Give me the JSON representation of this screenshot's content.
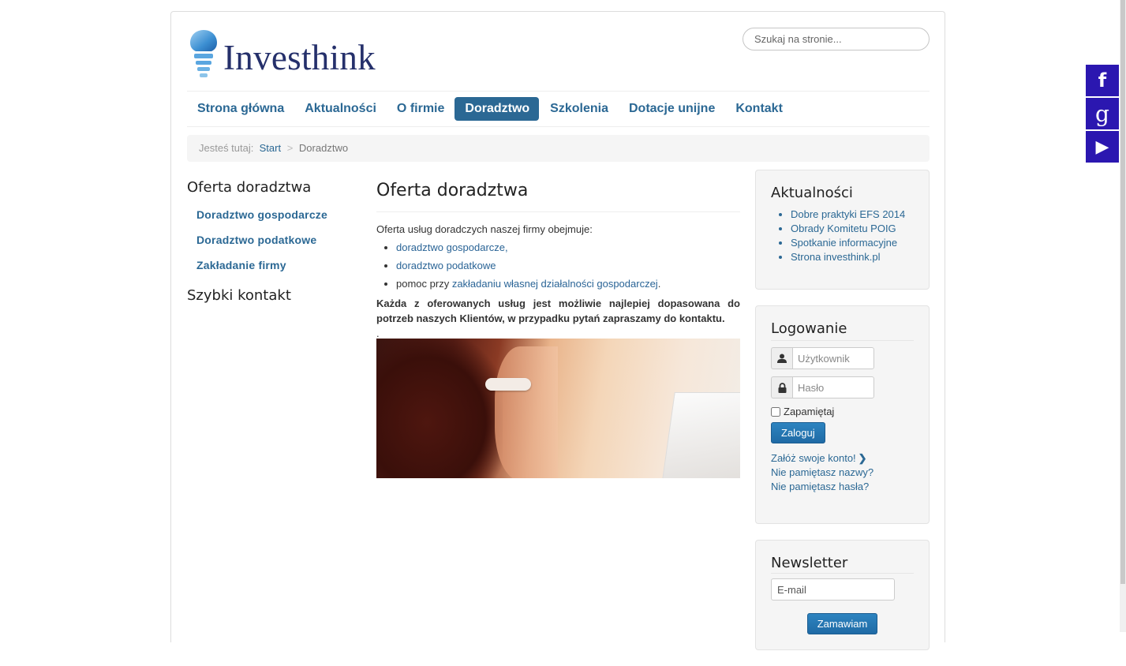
{
  "header": {
    "logo_text": "Investhink",
    "search_placeholder": "Szukaj na stronie..."
  },
  "nav": {
    "items": [
      "Strona główna",
      "Aktualności",
      "O firmie",
      "Doradztwo",
      "Szkolenia",
      "Dotacje unijne",
      "Kontakt"
    ],
    "active": "Doradztwo"
  },
  "breadcrumb": {
    "prefix": "Jesteś tutaj:",
    "home": "Start",
    "separator": ">",
    "current": "Doradztwo"
  },
  "sidebar": {
    "title": "Oferta doradztwa",
    "items": [
      "Doradztwo gospodarcze",
      "Doradztwo podatkowe",
      "Zakładanie firmy"
    ],
    "contact_title": "Szybki kontakt"
  },
  "main": {
    "title": "Oferta doradztwa",
    "intro": "Oferta usług doradczych naszej firmy obejmuje:",
    "list": {
      "item1": "doradztwo gospodarcze,",
      "item2": "doradztwo podatkowe",
      "item3_prefix": "pomoc przy ",
      "item3_link": "zakładaniu własnej działalności gospodarczej",
      "item3_suffix": "."
    },
    "bold_text": "Każda z oferowanych usług jest możliwie najlepiej dopasowana do potrzeb naszych Klientów, w przypadku pytań zapraszamy do kontaktu.",
    "dot": "."
  },
  "news": {
    "title": "Aktualności",
    "items": [
      "Dobre praktyki EFS 2014",
      "Obrady Komitetu POIG",
      "Spotkanie informacyjne",
      "Strona investhink.pl"
    ]
  },
  "login": {
    "title": "Logowanie",
    "username_placeholder": "Użytkownik",
    "password_placeholder": "Hasło",
    "remember_label": "Zapamiętaj",
    "submit_label": "Zaloguj",
    "register_link": "Załóż swoje konto!",
    "forgot_username": "Nie pamiętasz nazwy?",
    "forgot_password": "Nie pamiętasz hasła?"
  },
  "newsletter": {
    "title": "Newsletter",
    "email_placeholder": "E-mail",
    "submit_label": "Zamawiam"
  },
  "social": {
    "facebook": "f",
    "google": "g",
    "youtube": "▶"
  },
  "colors": {
    "accent": "#2b6894",
    "social": "#2b17b0",
    "logo": "#25306b"
  }
}
